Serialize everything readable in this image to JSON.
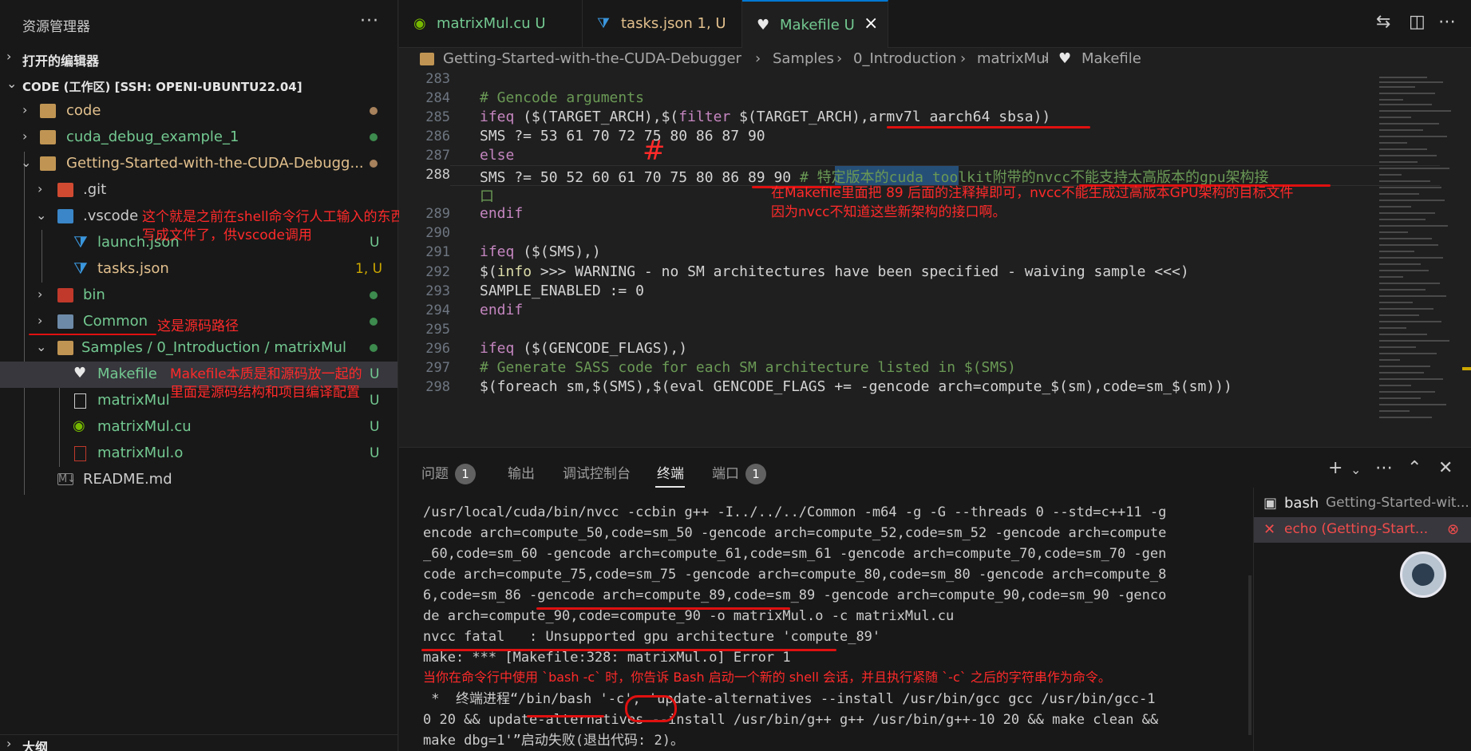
{
  "sidebar": {
    "title": "资源管理器",
    "more": "···",
    "open_editors": "打开的编辑器",
    "workspace": "CODE (工作区) [SSH: OPENI-UBUNTU22.04]",
    "items": [
      {
        "label": "code"
      },
      {
        "label": "cuda_debug_example_1"
      },
      {
        "label": "Getting-Started-with-the-CUDA-Debugg..."
      },
      {
        "label": ".git"
      },
      {
        "label": ".vscode"
      },
      {
        "label": "launch.json",
        "status": "U"
      },
      {
        "label": "tasks.json",
        "status": "1, U"
      },
      {
        "label": "bin"
      },
      {
        "label": "Common"
      },
      {
        "label": "Samples / 0_Introduction / matrixMul"
      },
      {
        "label": "Makefile",
        "status": "U"
      },
      {
        "label": "matrixMul",
        "status": "U"
      },
      {
        "label": "matrixMul.cu",
        "status": "U"
      },
      {
        "label": "matrixMul.o",
        "status": "U"
      },
      {
        "label": "README.md"
      }
    ],
    "outline": "大纲"
  },
  "annotations": {
    "vscode_1": "这个就是之前在shell命令行人工输入的东西",
    "vscode_2": "写成文件了，供vscode调用",
    "common": "这是源码路径",
    "makefile_1": "Makefile本质是和源码放一起的",
    "makefile_2": "里面是源码结构和项目编译配置",
    "editor_1": "在Makefile里面把 89 后面的注释掉即可，nvcc不能生成过高版本GPU架构的目标文件",
    "editor_2": "因为nvcc不知道这些新架构的接口啊。",
    "terminal": "当你在命令行中使用 `bash -c` 时，你告诉 Bash 启动一个新的 shell 会话，并且执行紧随 `-c` 之后的字符串作为命令。"
  },
  "tabs": [
    {
      "label": "matrixMul.cu",
      "status": "U"
    },
    {
      "label": "tasks.json",
      "status": "1, U"
    },
    {
      "label": "Makefile",
      "status": "U"
    }
  ],
  "breadcrumb": [
    "Getting-Started-with-the-CUDA-Debugger",
    "Samples",
    "0_Introduction",
    "matrixMul",
    "Makefile"
  ],
  "editor": {
    "line_numbers": [
      "283",
      "284",
      "285",
      "286",
      "287",
      "288",
      "",
      "289",
      "290",
      "291",
      "292",
      "293",
      "294",
      "295",
      "296",
      "297",
      "298"
    ],
    "lines": {
      "l284": "# Gencode arguments",
      "l285a": "ifeq",
      "l285b": " ($(TARGET_ARCH),$(",
      "l285c": "filter",
      "l285d": " $(TARGET_ARCH),armv7l aarch64 sbsa))",
      "l286": "SMS ?= 53 61 70 72 75 80 86 87 90",
      "l287": "else",
      "l288a": "SMS ?= 50 52 60 61 70 75 80 86 89 90 ",
      "l288b": "# 特定版本的cuda toolkit附带的nvcc不能支持太高版本的gpu架构接",
      "l288c": "口",
      "l289": "endif",
      "l291a": "ifeq",
      "l291b": " ($(SMS),)",
      "l292a": "$(",
      "l292b": "info",
      "l292c": " >>> WARNING - no SM architectures have been specified - waiving sample <<<)",
      "l293": "SAMPLE_ENABLED := 0",
      "l294": "endif",
      "l296a": "ifeq",
      "l296b": " ($(GENCODE_FLAGS),)",
      "l297": "# Generate SASS code for each SM architecture listed in $(SMS)",
      "l298": "$(foreach sm,$(SMS),$(eval GENCODE_FLAGS += -gencode arch=compute_$(sm),code=sm_$(sm)))"
    }
  },
  "panel": {
    "tabs": [
      {
        "label": "问题",
        "badge": "1"
      },
      {
        "label": "输出"
      },
      {
        "label": "调试控制台"
      },
      {
        "label": "终端"
      },
      {
        "label": "端口",
        "badge": "1"
      }
    ],
    "terminal_lines": [
      "/usr/local/cuda/bin/nvcc -ccbin g++ -I../../../Common -m64 -g -G --threads 0 --std=c++11 -g",
      "encode arch=compute_50,code=sm_50 -gencode arch=compute_52,code=sm_52 -gencode arch=compute",
      "_60,code=sm_60 -gencode arch=compute_61,code=sm_61 -gencode arch=compute_70,code=sm_70 -gen",
      "code arch=compute_75,code=sm_75 -gencode arch=compute_80,code=sm_80 -gencode arch=compute_8",
      "6,code=sm_86 -gencode arch=compute_89,code=sm_89 -gencode arch=compute_90,code=sm_90 -genco",
      "de arch=compute_90,code=compute_90 -o matrixMul.o -c matrixMul.cu",
      "nvcc fatal   : Unsupported gpu architecture 'compute_89'",
      "make: *** [Makefile:328: matrixMul.o] Error 1"
    ],
    "task_lines": [
      " *  终端进程“/bin/bash '-c', 'update-alternatives --install /usr/bin/gcc gcc /usr/bin/gcc-1",
      "0 20 && update-alternatives --install /usr/bin/g++ g++ /usr/bin/g++-10 20 && make clean &&",
      "make dbg=1'”启动失败(退出代码: 2)。"
    ],
    "terminals": [
      {
        "name": "bash",
        "detail": "Getting-Started-wit..."
      },
      {
        "name": "echo (Getting-Start..."
      }
    ]
  }
}
